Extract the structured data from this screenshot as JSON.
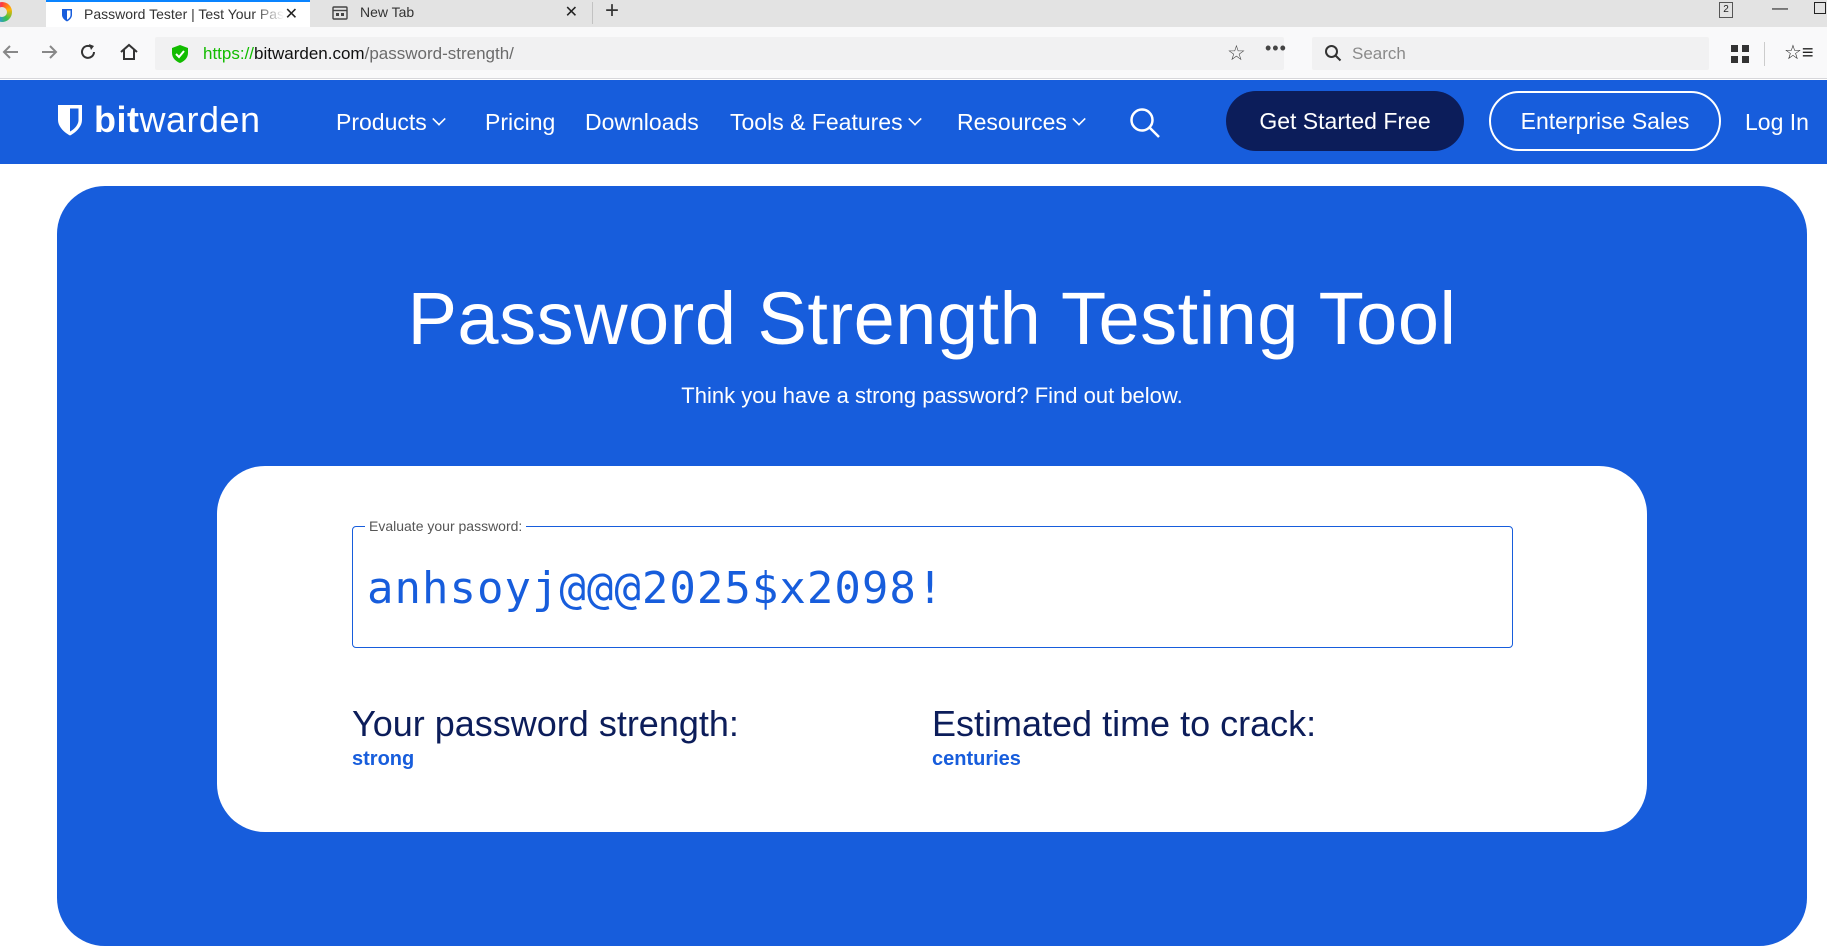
{
  "browser": {
    "tabs": [
      {
        "title": "Password Tester | Test Your Password Strength",
        "close_glyph": "✕"
      },
      {
        "title": "New Tab",
        "close_glyph": "✕"
      }
    ],
    "new_tab_glyph": "+",
    "window_badge": "2",
    "url": {
      "scheme": "https://",
      "host": "bitwarden.com",
      "path": "/password-strength/"
    },
    "search_placeholder": "Search",
    "icons": [
      "back-icon",
      "forward-icon",
      "reload-icon",
      "home-icon",
      "shield-icon",
      "star-icon",
      "more-icon",
      "search-icon",
      "library-icon",
      "bookmarks-icon"
    ]
  },
  "header": {
    "logo": {
      "bold": "bit",
      "regular": "warden"
    },
    "nav": [
      {
        "label": "Products",
        "dropdown": true
      },
      {
        "label": "Pricing",
        "dropdown": false
      },
      {
        "label": "Downloads",
        "dropdown": false
      },
      {
        "label": "Tools & Features",
        "dropdown": true
      },
      {
        "label": "Resources",
        "dropdown": true
      }
    ],
    "cta_primary": "Get Started Free",
    "cta_secondary": "Enterprise Sales",
    "login": "Log In"
  },
  "hero": {
    "title": "Password Strength Testing Tool",
    "subtitle": "Think you have a strong password? Find out below."
  },
  "tester": {
    "field_label": "Evaluate your password:",
    "password_value": "anhsoyj@@@2025$x2098!",
    "strength_label": "Your password strength:",
    "strength_value": "strong",
    "crack_label": "Estimated time to crack:",
    "crack_value": "centuries"
  },
  "colors": {
    "brand_blue": "#175ddc",
    "navy": "#0c1d5a",
    "secure_green": "#12bc00"
  }
}
